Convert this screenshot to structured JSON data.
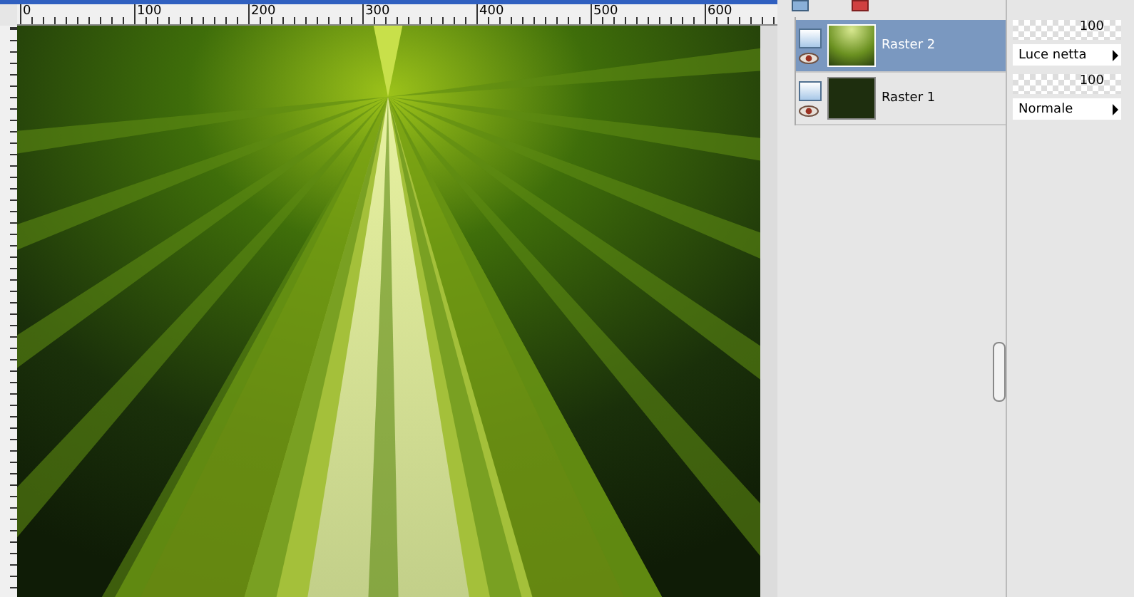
{
  "ruler": {
    "labels": [
      "0",
      "100",
      "200",
      "300",
      "400",
      "500",
      "600"
    ]
  },
  "layers": [
    {
      "name": "Raster 2",
      "selected": true,
      "visible": true,
      "opacity": "100",
      "blend": "Luce netta"
    },
    {
      "name": "Raster 1",
      "selected": false,
      "visible": true,
      "opacity": "100",
      "blend": "Normale"
    }
  ]
}
